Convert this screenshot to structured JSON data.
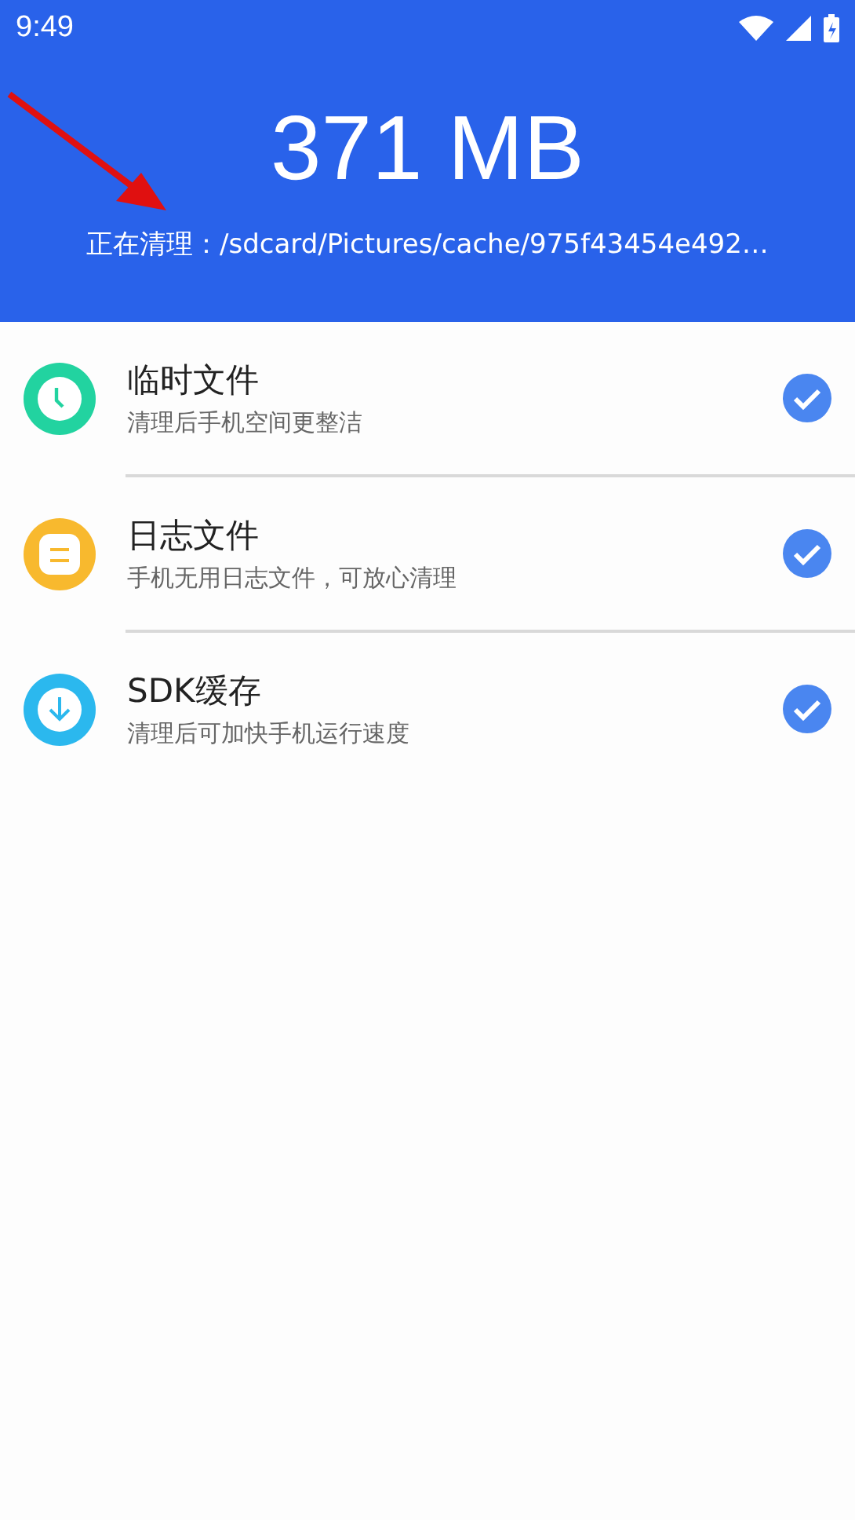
{
  "status_bar": {
    "time": "9:49"
  },
  "header": {
    "size": "371 MB",
    "cleaning_label": "正在清理：/sdcard/Pictures/cache/975f43454e492…"
  },
  "items": [
    {
      "kind": "clock",
      "color": "#22d3a0",
      "title": "临时文件",
      "subtitle": "清理后手机空间更整洁",
      "checked": true
    },
    {
      "kind": "log",
      "color": "#f8b92e",
      "title": "日志文件",
      "subtitle": "手机无用日志文件，可放心清理",
      "checked": true
    },
    {
      "kind": "download",
      "color": "#2bb8ee",
      "title": "SDK缓存",
      "subtitle": "清理后可加快手机运行速度",
      "checked": true
    }
  ]
}
